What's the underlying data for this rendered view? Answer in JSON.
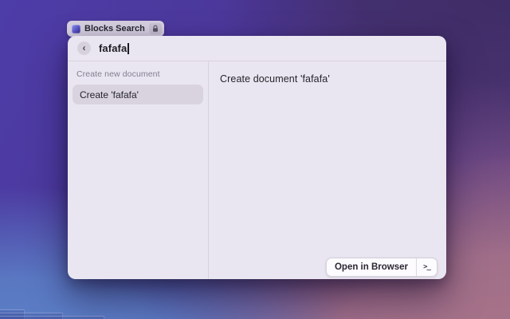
{
  "badge": {
    "label": "Blocks Search",
    "app_icon": "blocks-app-icon",
    "privacy_icon": "lock-icon"
  },
  "window": {
    "search": {
      "value": "fafafa",
      "back_icon": "chevron-left-icon",
      "chevron_glyph": "‹"
    },
    "left_panel": {
      "section_header": "Create new document",
      "items": [
        {
          "label": "Create 'fafafa'",
          "selected": true
        }
      ]
    },
    "right_panel": {
      "title": "Create document 'fafafa'"
    },
    "footer": {
      "open_label": "Open in Browser",
      "terminal_glyph": ">_",
      "terminal_icon": "terminal-prompt-icon"
    }
  },
  "colors": {
    "window_bg": "#eae6f1",
    "divider": "#d8d2de",
    "selected_row": "#d9d3df",
    "badge_bg": "#d6d0e0",
    "text_dark": "#26232c",
    "text_muted": "#827d8d",
    "wallpaper_top_left": "#4d3da8",
    "wallpaper_top_right": "#3e2c66",
    "wallpaper_bottom_left": "#5c82c8",
    "wallpaper_bottom_right": "#a8748a"
  }
}
